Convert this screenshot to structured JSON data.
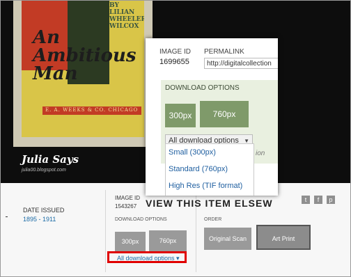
{
  "poster": {
    "top_text": "BY\nLILIAN\nWHEELER\nWILCOX",
    "title_line1": "An",
    "title_line2": "Ambitious",
    "title_line3": "Man",
    "publisher": "E. A. WEEKS & CO. CHICAGO"
  },
  "blog": {
    "title": "Julia Says",
    "url": "julia00.blogspot.com"
  },
  "info": {
    "date_label": "DATE ISSUED",
    "date_value": "1895 - 1911",
    "image_id_label": "IMAGE ID",
    "image_id_value": "1543267",
    "download_label": "DOWNLOAD OPTIONS",
    "btn_300": "300px",
    "btn_760": "760px",
    "all_download": "All download options ▾",
    "order_label": "ORDER",
    "original_scan": "Original Scan",
    "art_print": "Art Print"
  },
  "social": {
    "twitter": "t",
    "facebook": "f",
    "pinterest": "p"
  },
  "zoom": {
    "image_id_label": "IMAGE ID",
    "image_id_value": "1699655",
    "permalink_label": "PERMALINK",
    "permalink_value": "http://digitalcollection",
    "download_label": "DOWNLOAD OPTIONS",
    "btn_300": "300px",
    "btn_760": "760px",
    "select_label": "All download options",
    "menu": [
      "Small (300px)",
      "Standard (760px)",
      "High Res (TIF format)"
    ],
    "partial_text": "ion",
    "elsewhere": "VIEW THIS ITEM ELSEW"
  },
  "colors": {
    "accent_link": "#1a6aa5",
    "zoom_button": "#7f9a6a",
    "highlight": "#e00000"
  }
}
